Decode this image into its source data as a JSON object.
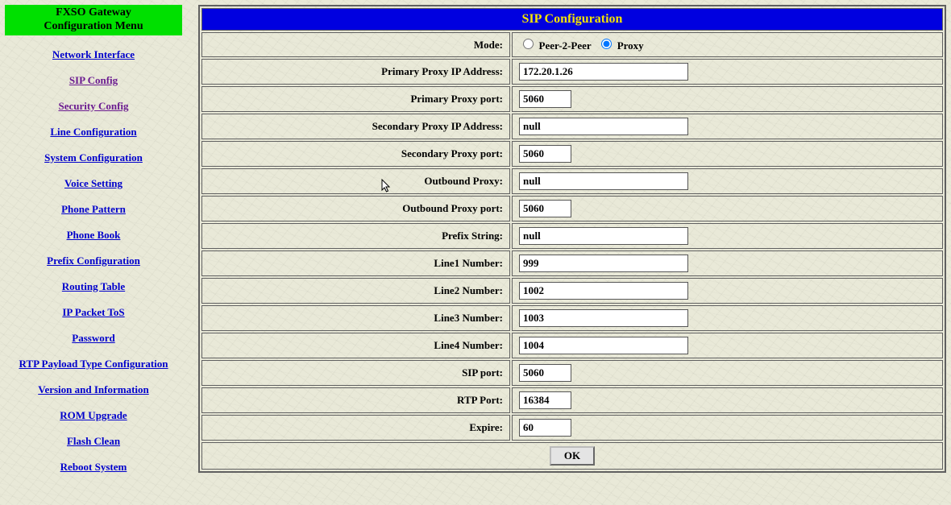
{
  "sidebar": {
    "title_line1": "FXSO Gateway",
    "title_line2": "Configuration Menu",
    "items": [
      {
        "label": "Network Interface",
        "visited": false
      },
      {
        "label": "SIP Config",
        "visited": true
      },
      {
        "label": "Security Config",
        "visited": true
      },
      {
        "label": "Line Configuration",
        "visited": false
      },
      {
        "label": "System Configuration",
        "visited": false
      },
      {
        "label": "Voice Setting",
        "visited": false
      },
      {
        "label": "Phone Pattern",
        "visited": false
      },
      {
        "label": "Phone Book",
        "visited": false
      },
      {
        "label": "Prefix Configuration",
        "visited": false
      },
      {
        "label": "Routing Table",
        "visited": false
      },
      {
        "label": "IP Packet ToS",
        "visited": false
      },
      {
        "label": "Password",
        "visited": false
      },
      {
        "label": "RTP Payload Type Configuration",
        "visited": false
      },
      {
        "label": "Version and Information",
        "visited": false
      },
      {
        "label": "ROM Upgrade",
        "visited": false
      },
      {
        "label": "Flash Clean",
        "visited": false
      },
      {
        "label": "Reboot System",
        "visited": false
      }
    ]
  },
  "page": {
    "title": "SIP Configuration",
    "mode": {
      "label": "Mode:",
      "option_p2p": "Peer-2-Peer",
      "option_proxy": "Proxy",
      "selected": "Proxy"
    },
    "rows": [
      {
        "label": "Primary Proxy IP Address:",
        "value": "172.20.1.26",
        "size": "wide"
      },
      {
        "label": "Primary Proxy port:",
        "value": "5060",
        "size": "short"
      },
      {
        "label": "Secondary Proxy IP Address:",
        "value": "null",
        "size": "wide"
      },
      {
        "label": "Secondary Proxy port:",
        "value": "5060",
        "size": "short"
      },
      {
        "label": "Outbound Proxy:",
        "value": "null",
        "size": "wide"
      },
      {
        "label": "Outbound Proxy port:",
        "value": "5060",
        "size": "short"
      },
      {
        "label": "Prefix String:",
        "value": "null",
        "size": "wide"
      },
      {
        "label": "Line1 Number:",
        "value": "999",
        "size": "wide"
      },
      {
        "label": "Line2 Number:",
        "value": "1002",
        "size": "wide"
      },
      {
        "label": "Line3 Number:",
        "value": "1003",
        "size": "wide"
      },
      {
        "label": "Line4 Number:",
        "value": "1004",
        "size": "wide"
      },
      {
        "label": "SIP port:",
        "value": "5060",
        "size": "short"
      },
      {
        "label": "RTP Port:",
        "value": "16384",
        "size": "short"
      },
      {
        "label": "Expire:",
        "value": "60",
        "size": "short"
      }
    ],
    "ok_label": "OK"
  }
}
